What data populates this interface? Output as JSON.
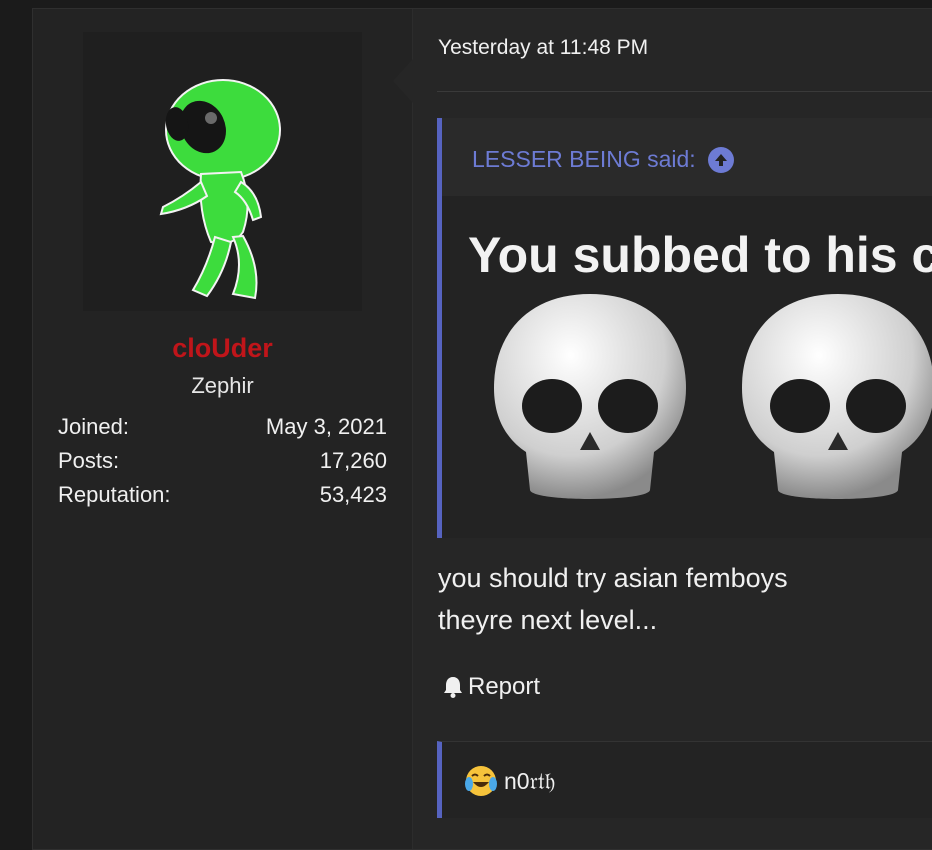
{
  "user": {
    "name": "cloUder",
    "title": "Zephir",
    "stats": [
      {
        "label": "Joined:",
        "value": "May 3, 2021"
      },
      {
        "label": "Posts:",
        "value": "17,260"
      },
      {
        "label": "Reputation:",
        "value": "53,423"
      }
    ]
  },
  "post": {
    "date": "Yesterday at 11:48 PM",
    "quote": {
      "author": "LESSER BEING said:",
      "text": "You subbed to his c"
    },
    "message": [
      "you should try asian femboys",
      "theyre next level..."
    ],
    "report_label": "Report"
  },
  "reactions": {
    "users": "n0𝔯𝔱𝔥"
  },
  "colors": {
    "username": "#c0151a",
    "quote_accent": "#5663c0",
    "quote_link": "#6d7bd4"
  }
}
